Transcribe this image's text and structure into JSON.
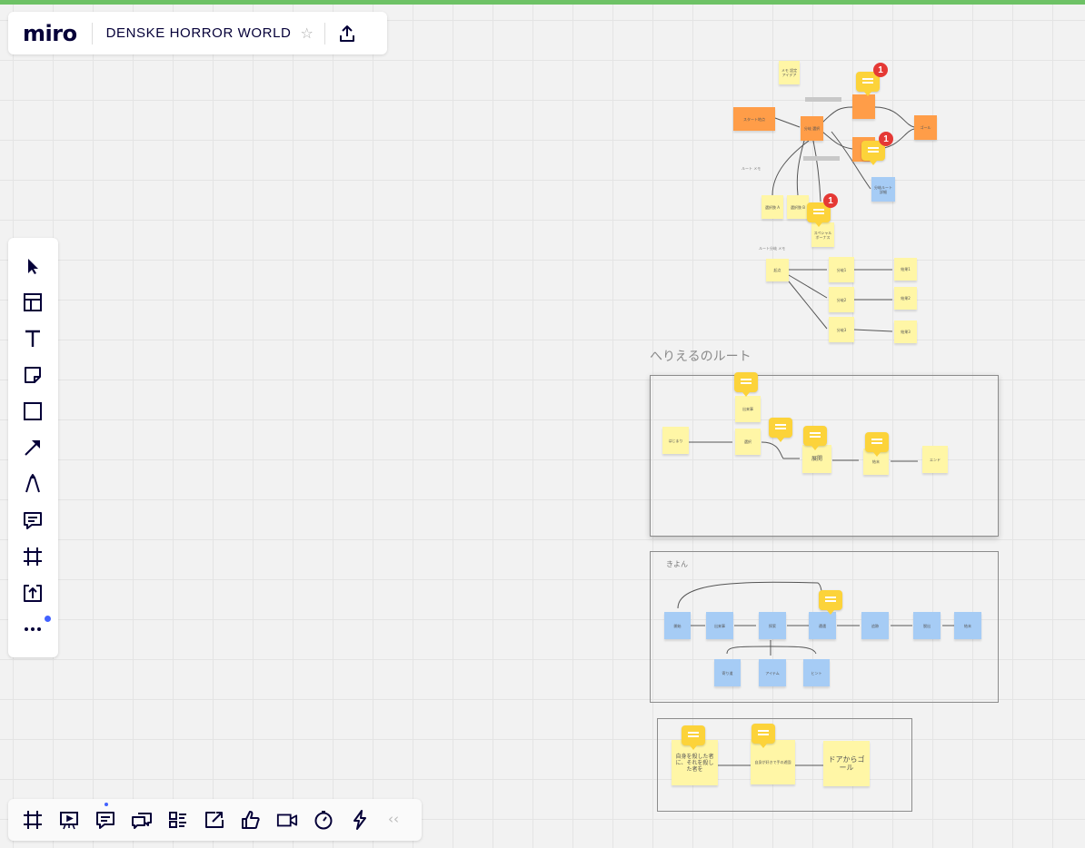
{
  "app": {
    "logo": "miro",
    "board_title": "DENSKE HORROR WORLD"
  },
  "left_toolbar": [
    {
      "name": "select-tool",
      "icon": "cursor-icon"
    },
    {
      "name": "templates-tool",
      "icon": "template-icon"
    },
    {
      "name": "text-tool",
      "icon": "text-icon"
    },
    {
      "name": "sticky-note-tool",
      "icon": "sticky-note-icon"
    },
    {
      "name": "shape-tool",
      "icon": "square-icon"
    },
    {
      "name": "connection-line-tool",
      "icon": "arrow-icon"
    },
    {
      "name": "pen-tool",
      "icon": "pen-icon"
    },
    {
      "name": "comment-tool",
      "icon": "comment-icon"
    },
    {
      "name": "frame-tool",
      "icon": "frame-icon"
    },
    {
      "name": "upload-tool",
      "icon": "upload-icon"
    },
    {
      "name": "more-apps-tool",
      "icon": "more-icon"
    }
  ],
  "bottom_toolbar": [
    {
      "name": "frames-button",
      "icon": "frame-icon"
    },
    {
      "name": "present-button",
      "icon": "present-icon"
    },
    {
      "name": "comments-button",
      "icon": "comment-icon"
    },
    {
      "name": "chat-button",
      "icon": "chat-icon"
    },
    {
      "name": "cards-button",
      "icon": "cards-icon"
    },
    {
      "name": "share-screen-button",
      "icon": "screen-share-icon"
    },
    {
      "name": "voting-button",
      "icon": "thumbs-up-icon"
    },
    {
      "name": "video-button",
      "icon": "video-icon"
    },
    {
      "name": "timer-button",
      "icon": "timer-icon"
    },
    {
      "name": "activity-button",
      "icon": "lightning-icon"
    }
  ],
  "canvas": {
    "section_label": "へりえるのルート",
    "frame2_label": "きよん",
    "badges": [
      "1",
      "1",
      "1"
    ],
    "big_stickies": {
      "s1": "自身を殺した者に、それを殺した者を",
      "s2": "自身が好きで手の遊園",
      "s3": "ドアからゴール"
    }
  },
  "colors": {
    "accent": "#4262ff",
    "sticky_yellow": "#fff6a6",
    "sticky_orange": "#ff9d48",
    "sticky_blue": "#a6ccf5",
    "comment_yellow": "#fcd33a",
    "badge_red": "#e53935"
  }
}
